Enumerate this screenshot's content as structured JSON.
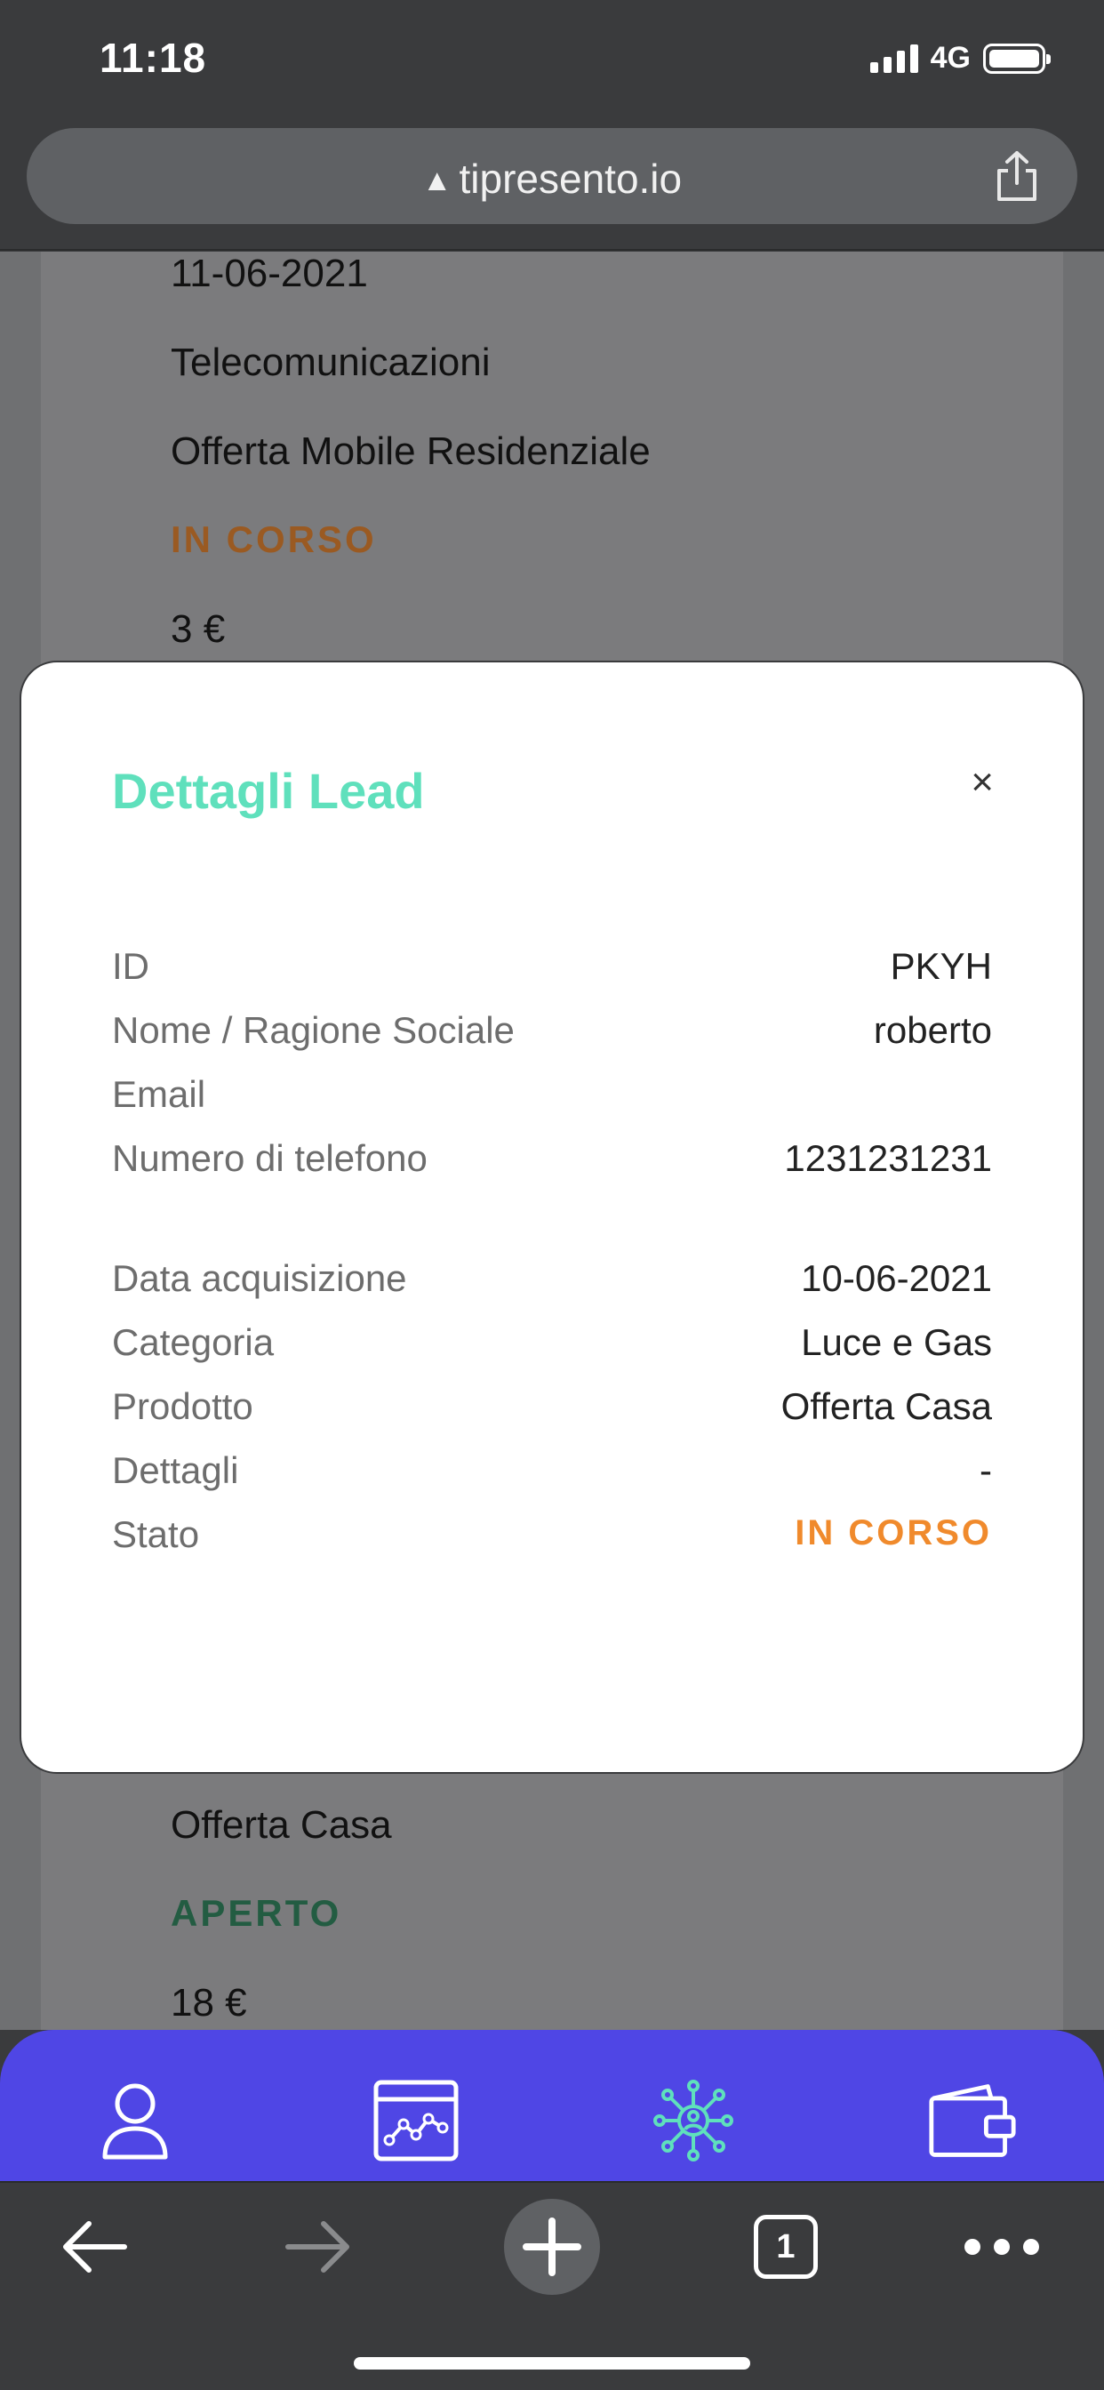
{
  "status_bar": {
    "time": "11:18",
    "network": "4G"
  },
  "browser": {
    "url": "tipresento.io",
    "tab_count": "1"
  },
  "background_list": {
    "top_item": {
      "date": "11-06-2021",
      "category": "Telecomunicazioni",
      "product": "Offerta Mobile Residenziale",
      "status": "IN CORSO",
      "amount": "3 €"
    },
    "bottom_item": {
      "product": "Offerta Casa",
      "status": "APERTO",
      "amount": "18 €"
    }
  },
  "modal": {
    "title": "Dettagli Lead",
    "close_label": "×",
    "rows": [
      {
        "label": "ID",
        "value": "PKYH"
      },
      {
        "label": "Nome / Ragione Sociale",
        "value": "roberto"
      },
      {
        "label": "Email",
        "value": ""
      },
      {
        "label": "Numero di telefono",
        "value": "1231231231"
      },
      {
        "label": "Data acquisizione",
        "value": "10-06-2021"
      },
      {
        "label": "Categoria",
        "value": "Luce e Gas"
      },
      {
        "label": "Prodotto",
        "value": "Offerta Casa"
      },
      {
        "label": "Dettagli",
        "value": "-"
      },
      {
        "label": "Stato",
        "value": "IN CORSO"
      }
    ]
  },
  "app_nav": {
    "items": [
      {
        "icon": "user-icon",
        "active": false
      },
      {
        "icon": "chart-icon",
        "active": false
      },
      {
        "icon": "network-icon",
        "active": true
      },
      {
        "icon": "wallet-icon",
        "active": false
      }
    ]
  },
  "colors": {
    "accent_teal": "#5fe0bc",
    "nav_purple": "#4f46e5",
    "status_orange": "#f08a2c",
    "status_green": "#235c42"
  }
}
